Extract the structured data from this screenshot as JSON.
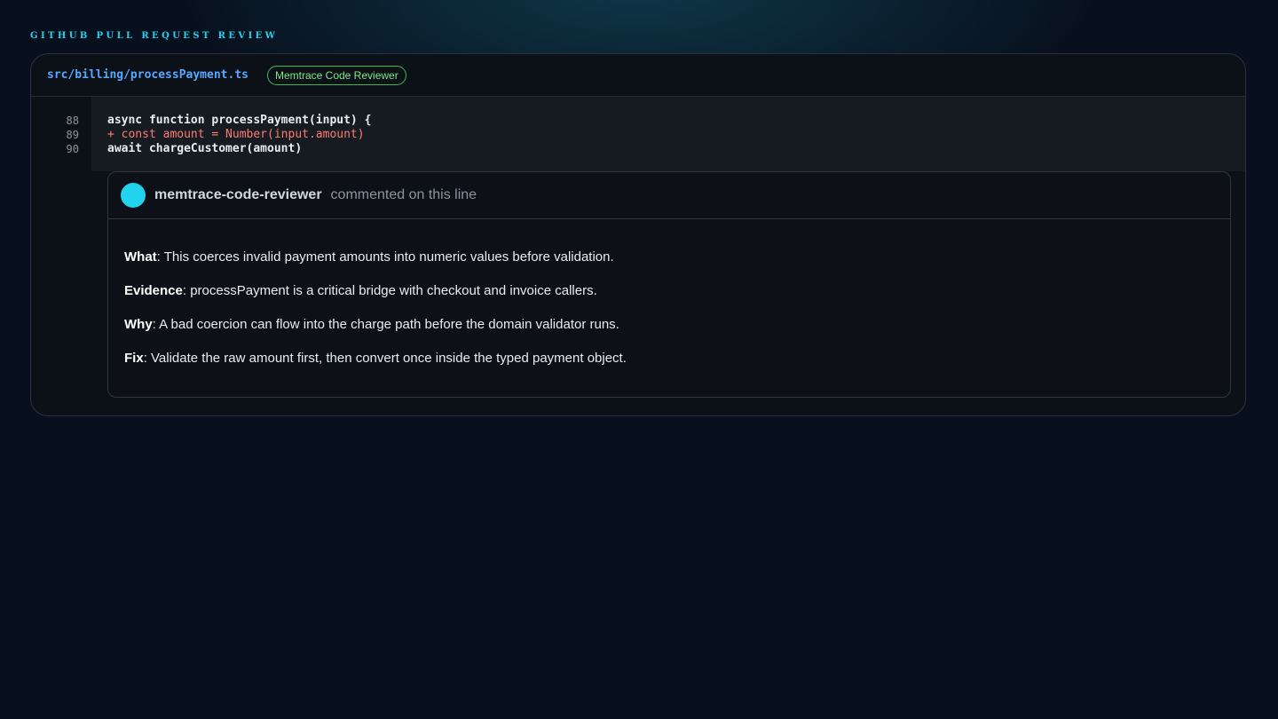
{
  "page": {
    "section_label": "GITHUB PULL REQUEST REVIEW"
  },
  "file": {
    "path": "src/billing/processPayment.ts",
    "reviewer_badge": "Memtrace Code Reviewer"
  },
  "code": {
    "lines": [
      {
        "number": "88",
        "text": "async function processPayment(input) {",
        "kind": "context"
      },
      {
        "number": "89",
        "text": "+ const amount = Number(input.amount)",
        "kind": "added"
      },
      {
        "number": "90",
        "text": "await chargeCustomer(amount)",
        "kind": "context"
      }
    ]
  },
  "comment": {
    "author": "memtrace-code-reviewer",
    "action": "commented on this line",
    "avatar_color": "#22d3ee",
    "paragraphs": [
      {
        "term": "What",
        "text": ": This coerces invalid payment amounts into numeric values before validation."
      },
      {
        "term": "Evidence",
        "text": ": processPayment is a critical bridge with checkout and invoice callers."
      },
      {
        "term": "Why",
        "text": ": A bad coercion can flow into the charge path before the domain validator runs."
      },
      {
        "term": "Fix",
        "text": ": Validate the raw amount first, then convert once inside the typed payment object."
      }
    ]
  },
  "colors": {
    "accent": "#22d3ee",
    "file_path": "#58a6ff",
    "badge_green": "#3fb950",
    "added_line": "#ff7b72"
  }
}
